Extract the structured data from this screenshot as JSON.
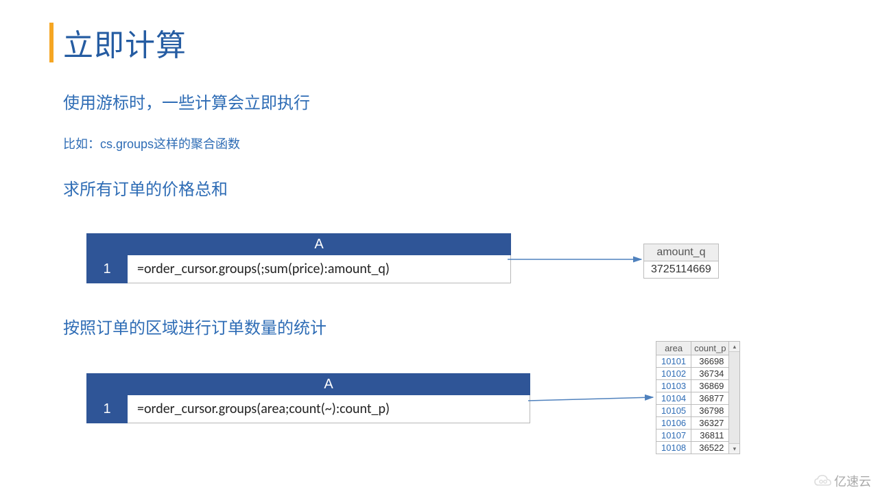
{
  "title": "立即计算",
  "subtitle": "使用游标时，一些计算会立即执行",
  "note": "比如：cs.groups这样的聚合函数",
  "section1": {
    "heading": "求所有订单的价格总和",
    "col_header": "A",
    "row_num": "1",
    "formula": "=order_cursor.groups(;sum(price):amount_q)"
  },
  "result1": {
    "header": "amount_q",
    "value": "3725114669"
  },
  "section2": {
    "heading": "按照订单的区域进行订单数量的统计",
    "col_header": "A",
    "row_num": "1",
    "formula": "=order_cursor.groups(area;count(~):count_p)"
  },
  "result2": {
    "headers": {
      "area": "area",
      "count_p": "count_p"
    },
    "rows": [
      {
        "area": "10101",
        "count": "36698"
      },
      {
        "area": "10102",
        "count": "36734"
      },
      {
        "area": "10103",
        "count": "36869"
      },
      {
        "area": "10104",
        "count": "36877"
      },
      {
        "area": "10105",
        "count": "36798"
      },
      {
        "area": "10106",
        "count": "36327"
      },
      {
        "area": "10107",
        "count": "36811"
      },
      {
        "area": "10108",
        "count": "36522"
      }
    ]
  },
  "watermark": "亿速云",
  "colors": {
    "accent_orange": "#f5a623",
    "heading_blue": "#255ca2",
    "text_blue": "#2e6cb5",
    "table_header_blue": "#2f5597",
    "arrow_blue": "#4f81bd"
  }
}
